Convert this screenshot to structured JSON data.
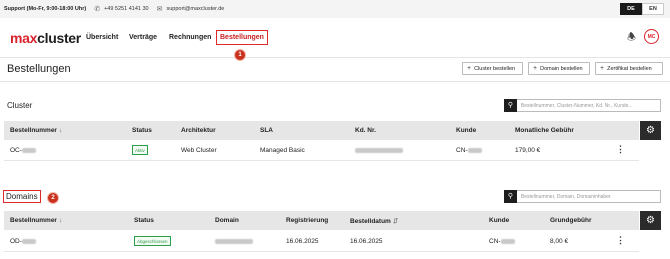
{
  "topbar": {
    "support": "Support (Mo-Fr, 9:00-18:00 Uhr)",
    "phone": "+49 5251 4141 30",
    "email": "support@maxcluster.de",
    "lang_de": "DE",
    "lang_en": "EN"
  },
  "nav": {
    "logo_max": "max",
    "logo_cluster": "cluster",
    "items": [
      "Übersicht",
      "Verträge",
      "Rechnungen",
      "Bestellungen"
    ],
    "active_item": "Bestellungen",
    "badge1": "1",
    "avatar": "MC"
  },
  "page": {
    "title": "Bestellungen",
    "buttons": [
      "Cluster bestellen",
      "Domain bestellen",
      "Zertifikat bestellen"
    ]
  },
  "cluster": {
    "title": "Cluster",
    "search_placeholder": "Bestellnummer, Cluster-Nummer, Kd. Nr., Kunde...",
    "columns": [
      "Bestellnummer",
      "Status",
      "Architektur",
      "SLA",
      "Kd. Nr.",
      "Kunde",
      "Monatliche Gebühr"
    ],
    "rows": [
      {
        "order": "OC-",
        "status": "Aktiv",
        "arch": "Web Cluster",
        "sla": "Managed Basic",
        "kdnr": "",
        "kunde": "CN-",
        "fee": "179,00 €"
      }
    ]
  },
  "domains": {
    "title": "Domains",
    "badge2": "2",
    "search_placeholder": "Bestellnummer, Domain, Domaininhaber",
    "columns": [
      "Bestellnummer",
      "Status",
      "Domain",
      "Registrierung",
      "Bestelldatum",
      "Kunde",
      "Grundgebühr"
    ],
    "rows": [
      {
        "order": "OD-",
        "status": "Abgeschlossen",
        "domain": "",
        "registrierung": "16.06.2025",
        "bestelldatum": "16.06.2025",
        "kunde": "CN-",
        "fee": "8,00 €"
      }
    ]
  },
  "icons": {
    "phone": "phone-icon",
    "mail": "mail-icon",
    "bell": "bell-icon",
    "search": "search-icon",
    "gear": "gear-icon",
    "plus": "plus-icon",
    "kebab": "kebab-icon"
  },
  "colors": {
    "brand_red": "#d9232d",
    "annotation_red": "#e02a2a",
    "status_green": "#2e9d4a",
    "dark": "#1e1e1e"
  }
}
